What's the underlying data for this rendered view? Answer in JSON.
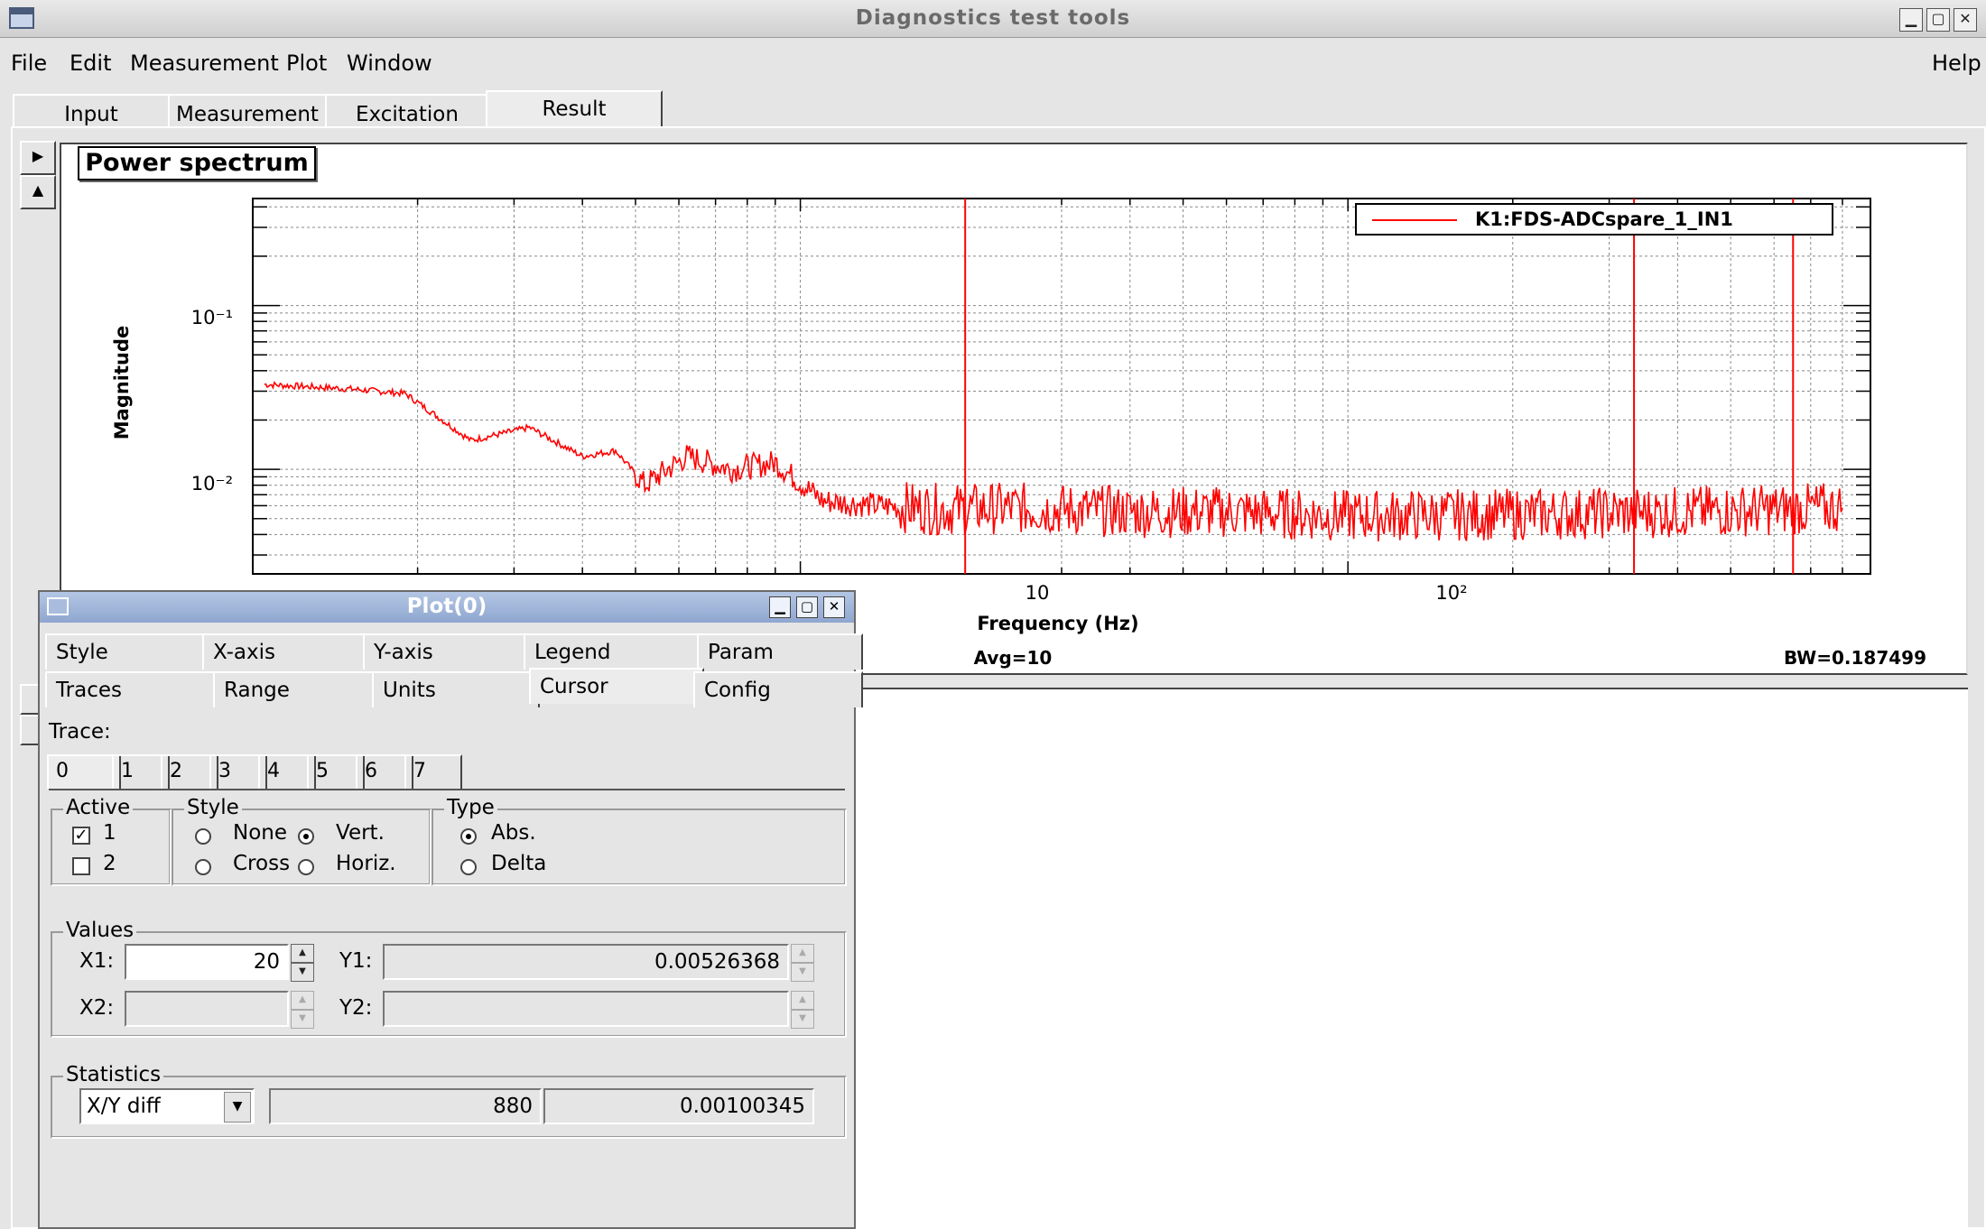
{
  "window": {
    "title": "Diagnostics test tools",
    "buttons": [
      "minimize",
      "maximize",
      "close"
    ]
  },
  "menu": {
    "file": "File",
    "edit": "Edit",
    "measurement": "Measurement",
    "plot": "Plot",
    "window": "Window",
    "help": "Help"
  },
  "main_tabs": [
    "Input",
    "Measurement",
    "Excitation",
    "Result"
  ],
  "selected_main_tab": "Result",
  "plot": {
    "panel_title": "Power spectrum",
    "bottom_left_text": "Avg=10",
    "bottom_right_text": "BW=0.187499"
  },
  "chart_data": {
    "type": "line",
    "title": "Power spectrum",
    "xlabel": "Frequency (Hz)",
    "ylabel": "Magnitude",
    "xscale": "log",
    "yscale": "log",
    "x_tick_labels": [
      "10",
      "10²"
    ],
    "y_tick_labels": [
      "10⁻¹",
      "10⁻²"
    ],
    "xlim": [
      1.0,
      900
    ],
    "ylim": [
      0.0023,
      0.45
    ],
    "grid": true,
    "legend_position": "top-right",
    "series": [
      {
        "name": "K1:FDS-ADCspare_1_IN1",
        "color": "#ff0000",
        "x": [
          1.05,
          1.5,
          1.9,
          2.5,
          3.2,
          4.0,
          4.6,
          5.2,
          6.2,
          7.5,
          9.0,
          11.0,
          14.0,
          18.0,
          25.0,
          40.0,
          60.0,
          100.0,
          200.0,
          400.0,
          800.0
        ],
        "y": [
          0.033,
          0.031,
          0.029,
          0.015,
          0.018,
          0.012,
          0.013,
          0.008,
          0.012,
          0.01,
          0.011,
          0.0064,
          0.006,
          0.0057,
          0.0058,
          0.0055,
          0.0055,
          0.0052,
          0.0053,
          0.0055,
          0.0058
        ],
        "spikes": [
          {
            "x": 20,
            "y": 0.45
          },
          {
            "x": 333,
            "y": 0.45
          },
          {
            "x": 650,
            "y": 0.45
          }
        ]
      }
    ]
  },
  "dialog": {
    "title": "Plot(0)",
    "tabs_row1": [
      "Style",
      "X-axis",
      "Y-axis",
      "Legend",
      "Param"
    ],
    "tabs_row2": [
      "Traces",
      "Range",
      "Units",
      "Cursor",
      "Config"
    ],
    "selected_tab": "Cursor",
    "trace_label": "Trace:",
    "trace_tabs": [
      "0",
      "1",
      "2",
      "3",
      "4",
      "5",
      "6",
      "7"
    ],
    "active": {
      "legend": "Active",
      "opt1": "1",
      "opt2": "2",
      "opt1_checked": true,
      "opt2_checked": false
    },
    "style": {
      "legend": "Style",
      "none": "None",
      "vert": "Vert.",
      "cross": "Cross",
      "horiz": "Horiz.",
      "selected": "Vert."
    },
    "type": {
      "legend": "Type",
      "abs": "Abs.",
      "delta": "Delta",
      "selected": "Abs."
    },
    "values": {
      "legend": "Values",
      "x1_label": "X1:",
      "x1": "20",
      "y1_label": "Y1:",
      "y1": "0.00526368",
      "x2_label": "X2:",
      "x2": "",
      "y2_label": "Y2:",
      "y2": ""
    },
    "statistics": {
      "legend": "Statistics",
      "mode": "X/Y diff",
      "value1": "880",
      "value2": "0.00100345"
    }
  }
}
